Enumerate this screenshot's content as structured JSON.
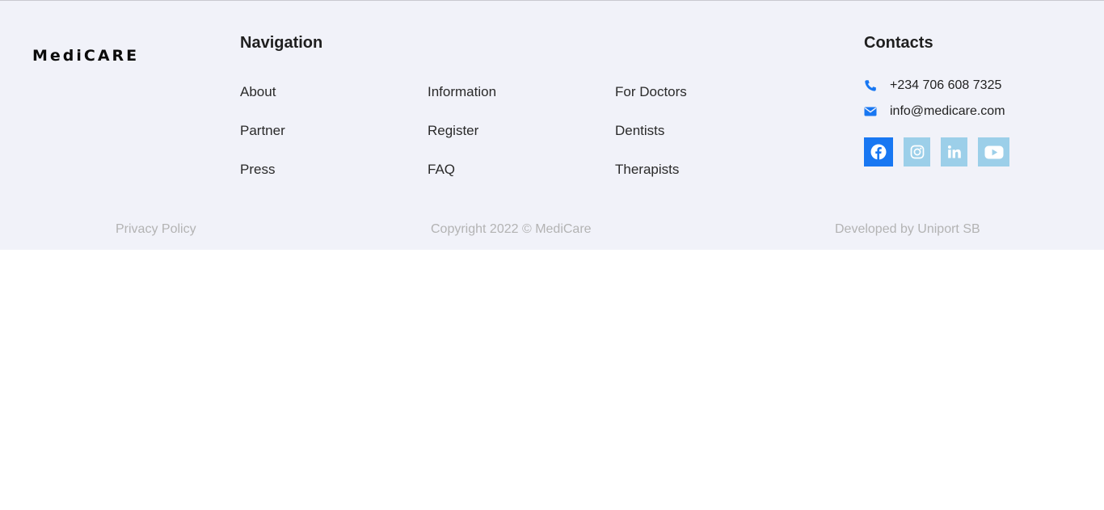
{
  "brand": {
    "logo_text": "MediCARE"
  },
  "navigation": {
    "title": "Navigation",
    "columns": [
      [
        "About",
        "Partner",
        "Press"
      ],
      [
        "Information",
        "Register",
        "FAQ"
      ],
      [
        "For Doctors",
        "Dentists",
        "Therapists"
      ]
    ]
  },
  "contacts": {
    "title": "Contacts",
    "phone": "+234 706 608 7325",
    "email": "info@medicare.com",
    "social": [
      "facebook-icon",
      "instagram-icon",
      "linkedin-icon",
      "youtube-icon"
    ]
  },
  "bottom_bar": {
    "privacy": "Privacy Policy",
    "copyright": "Copyright 2022 © MediCare",
    "developer": "Developed by Uniport SB"
  },
  "colors": {
    "footer_bg": "#f1f2f9",
    "accent": "#1877f2",
    "social_inactive": "#9ccfe9",
    "muted_text": "#b3b3b3"
  }
}
